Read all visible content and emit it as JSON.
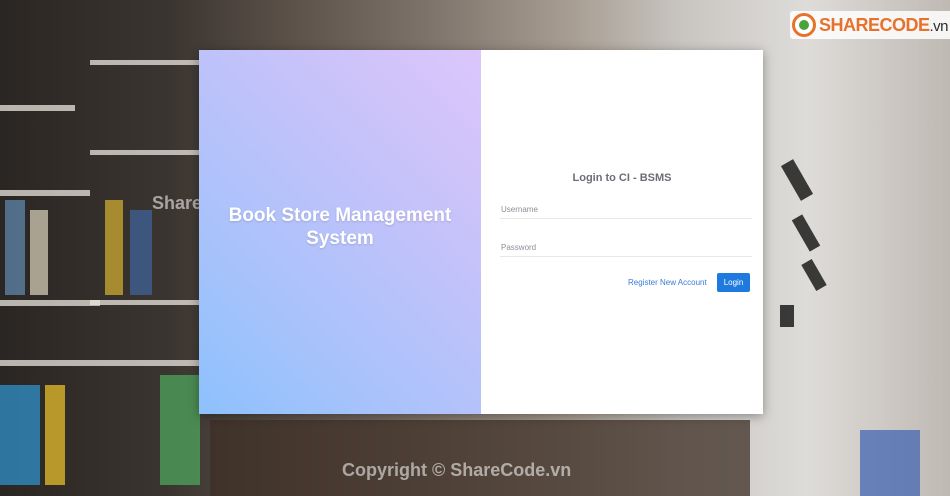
{
  "brand_logo": {
    "text": "SHARECODE.vn"
  },
  "watermarks": {
    "top": "ShareCode.vn",
    "bottom": "Copyright © ShareCode.vn"
  },
  "left_panel": {
    "title": "Book Store Management System"
  },
  "login": {
    "title": "Login to CI - BSMS",
    "username_placeholder": "Username",
    "password_placeholder": "Password",
    "register_link": "Register New Account",
    "login_button": "Login"
  },
  "colors": {
    "login_button_bg": "#1f7ae0",
    "register_link": "#3a7bd5",
    "gradient_start": "#8dc1fd",
    "gradient_end": "#dcc6fb"
  }
}
